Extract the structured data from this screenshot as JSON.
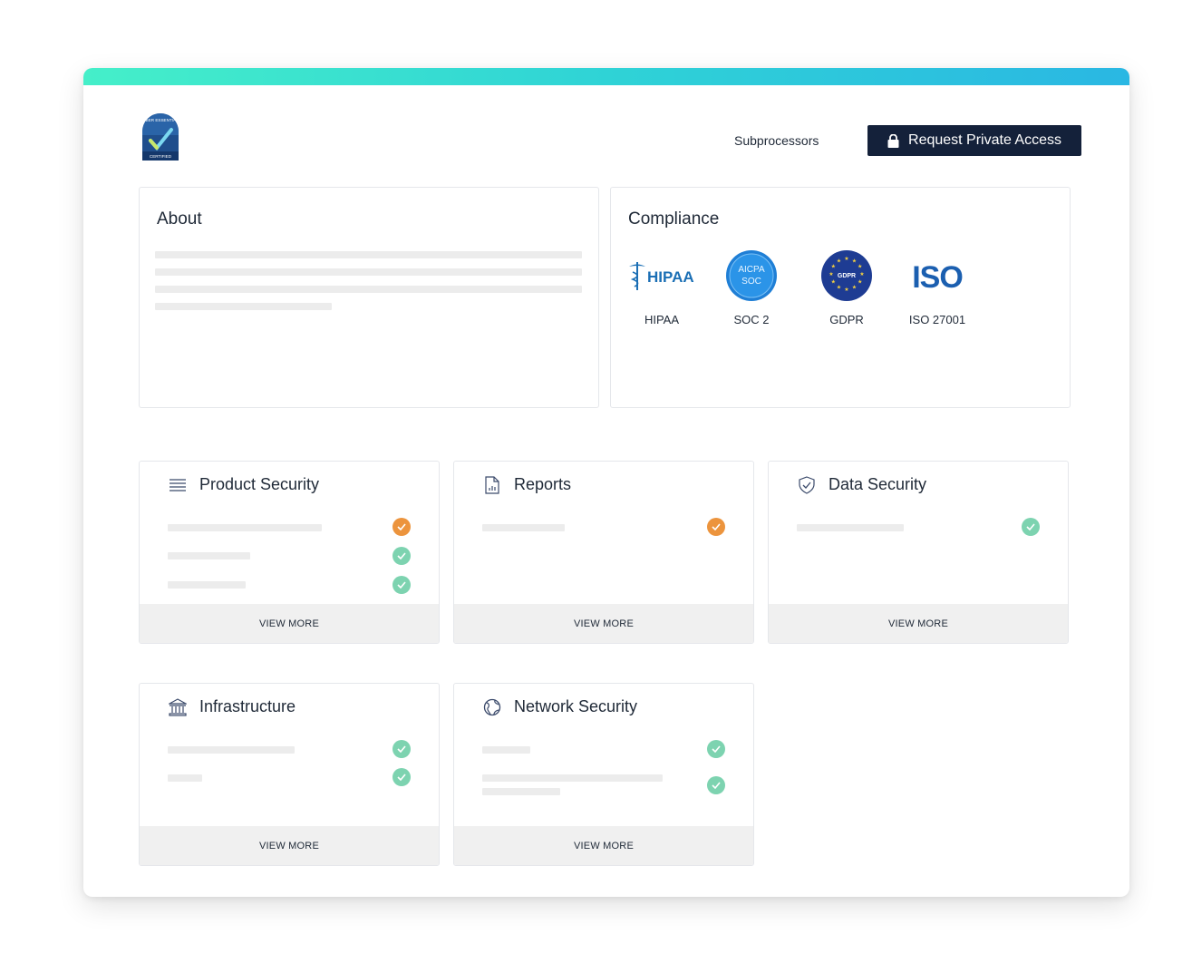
{
  "header": {
    "logo_text_top": "CYBER ESSENTIALS",
    "logo_text_bottom": "CERTIFIED",
    "nav_link": "Subprocessors",
    "cta_label": "Request Private Access"
  },
  "about": {
    "title": "About"
  },
  "compliance": {
    "title": "Compliance",
    "badges": [
      {
        "label": "HIPAA",
        "logo_text": "HIPAA"
      },
      {
        "label": "SOC 2",
        "logo_text_top": "AICPA",
        "logo_text_bottom": "SOC"
      },
      {
        "label": "GDPR",
        "logo_text": "GDPR"
      },
      {
        "label": "ISO 27001",
        "logo_text": "ISO"
      }
    ]
  },
  "cards": [
    {
      "title": "Product Security",
      "icon": "list-icon",
      "footer": "VIEW MORE",
      "statuses": [
        "orange",
        "green",
        "green"
      ]
    },
    {
      "title": "Reports",
      "icon": "document-chart-icon",
      "footer": "VIEW MORE",
      "statuses": [
        "orange"
      ]
    },
    {
      "title": "Data Security",
      "icon": "shield-check-icon",
      "footer": "VIEW MORE",
      "statuses": [
        "green"
      ]
    },
    {
      "title": "Infrastructure",
      "icon": "building-icon",
      "footer": "VIEW MORE",
      "statuses": [
        "green",
        "green"
      ]
    },
    {
      "title": "Network Security",
      "icon": "globe-icon",
      "footer": "VIEW MORE",
      "statuses": [
        "green",
        "green"
      ]
    }
  ],
  "colors": {
    "accent_gradient": [
      "#45efc9",
      "#2ab7e3"
    ],
    "button_bg": "#14213a",
    "status_green": "#7dd3b0",
    "status_orange": "#ec943d"
  }
}
